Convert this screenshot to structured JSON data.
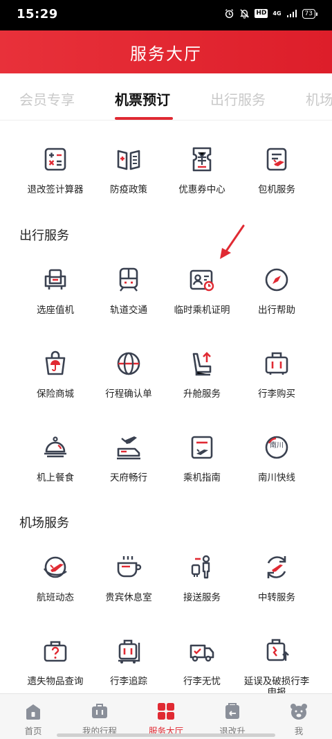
{
  "status_bar": {
    "time": "15:29",
    "hd": "HD",
    "network": "4G",
    "battery": "73"
  },
  "header": {
    "title": "服务大厅"
  },
  "tabs": [
    {
      "label": "会员专享",
      "active": false
    },
    {
      "label": "机票预订",
      "active": true
    },
    {
      "label": "出行服务",
      "active": false
    },
    {
      "label": "机场",
      "active": false
    }
  ],
  "top_services": [
    {
      "label": "退改签计算器",
      "icon": "calculator-icon"
    },
    {
      "label": "防疫政策",
      "icon": "policy-book-icon"
    },
    {
      "label": "优惠券中心",
      "icon": "coupon-icon"
    },
    {
      "label": "包机服务",
      "icon": "charter-document-icon"
    }
  ],
  "travel_section": {
    "title": "出行服务",
    "items": [
      {
        "label": "选座值机",
        "icon": "seat-icon"
      },
      {
        "label": "轨道交通",
        "icon": "train-icon"
      },
      {
        "label": "临时乘机证明",
        "icon": "id-card-icon"
      },
      {
        "label": "出行帮助",
        "icon": "compass-icon"
      },
      {
        "label": "保险商城",
        "icon": "insurance-bag-icon"
      },
      {
        "label": "行程确认单",
        "icon": "globe-icon"
      },
      {
        "label": "升舱服务",
        "icon": "seat-upgrade-icon"
      },
      {
        "label": "行李购买",
        "icon": "luggage-icon"
      },
      {
        "label": "机上餐食",
        "icon": "meal-cloche-icon"
      },
      {
        "label": "天府畅行",
        "icon": "plane-train-icon"
      },
      {
        "label": "乘机指南",
        "icon": "guide-icon"
      },
      {
        "label": "南川快线",
        "icon": "nanchuan-badge-icon",
        "badge_text": "南川"
      }
    ]
  },
  "airport_section": {
    "title": "机场服务",
    "items": [
      {
        "label": "航班动态",
        "icon": "flight-status-icon"
      },
      {
        "label": "贵宾休息室",
        "icon": "lounge-cup-icon"
      },
      {
        "label": "接送服务",
        "icon": "transfer-person-icon"
      },
      {
        "label": "中转服务",
        "icon": "transit-icon"
      },
      {
        "label": "遗失物品查询",
        "icon": "lost-item-icon"
      },
      {
        "label": "行李追踪",
        "icon": "baggage-tracking-icon"
      },
      {
        "label": "行李无忧",
        "icon": "baggage-truck-icon"
      },
      {
        "label": "延误及破损行李申报",
        "icon": "damaged-luggage-icon"
      }
    ]
  },
  "bottom_nav": [
    {
      "label": "首页",
      "icon": "home-icon",
      "active": false
    },
    {
      "label": "我的行程",
      "icon": "itinerary-icon",
      "active": false
    },
    {
      "label": "服务大厅",
      "icon": "grid-icon",
      "active": true
    },
    {
      "label": "退改升",
      "icon": "refund-icon",
      "active": false
    },
    {
      "label": "我",
      "icon": "bear-face-icon",
      "active": false
    }
  ],
  "colors": {
    "brand_red": "#e02a33",
    "icon_dark": "#3a4150",
    "inactive_tab": "#c9c9c9"
  }
}
